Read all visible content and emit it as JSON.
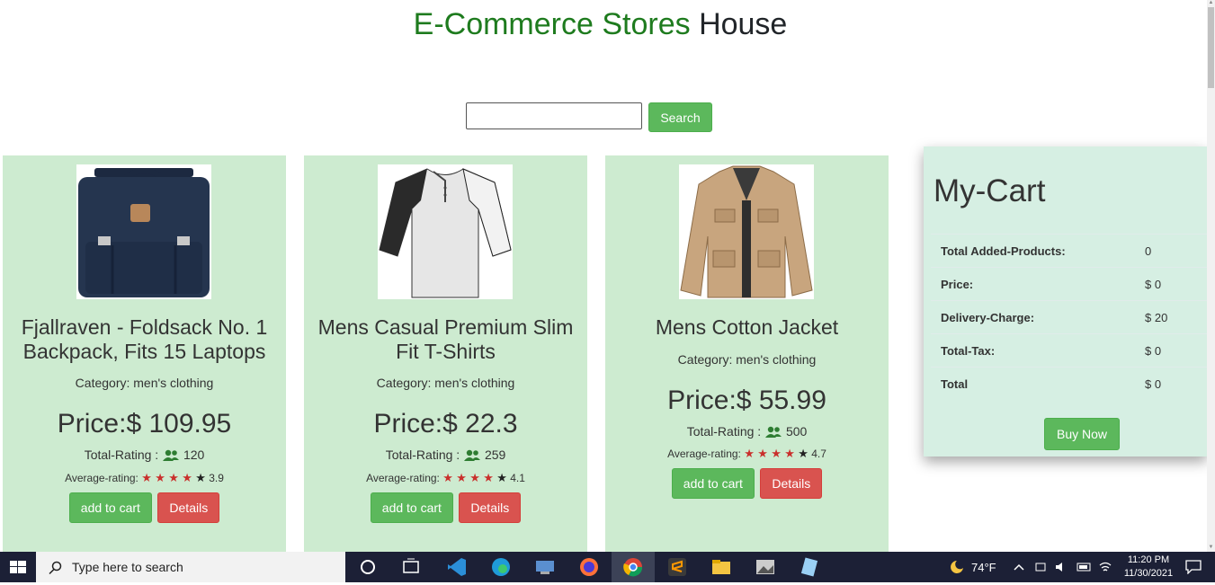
{
  "header": {
    "title_accent": "E-Commerce Stores",
    "title_plain": "House"
  },
  "search": {
    "button_label": "Search",
    "value": ""
  },
  "products": [
    {
      "name": "Fjallraven - Foldsack No. 1 Backpack, Fits 15 Laptops",
      "category": "Category: men's clothing",
      "price": "Price:$ 109.95",
      "total_rating_label": "Total-Rating :",
      "total_rating": "120",
      "avg_rating_label": "Average-rating:",
      "avg_rating": "3.9",
      "add_label": "add to cart",
      "details_label": "Details"
    },
    {
      "name": "Mens Casual Premium Slim Fit T-Shirts",
      "category": "Category: men's clothing",
      "price": "Price:$ 22.3",
      "total_rating_label": "Total-Rating :",
      "total_rating": "259",
      "avg_rating_label": "Average-rating:",
      "avg_rating": "4.1",
      "add_label": "add to cart",
      "details_label": "Details"
    },
    {
      "name": "Mens Cotton Jacket",
      "category": "Category: men's clothing",
      "price": "Price:$ 55.99",
      "total_rating_label": "Total-Rating :",
      "total_rating": "500",
      "avg_rating_label": "Average-rating:",
      "avg_rating": "4.7",
      "add_label": "add to cart",
      "details_label": "Details"
    }
  ],
  "cart": {
    "title": "My-Cart",
    "rows": [
      {
        "label": "Total Added-Products:",
        "value": "0"
      },
      {
        "label": "Price:",
        "value": "$ 0"
      },
      {
        "label": "Delivery-Charge:",
        "value": "$ 20"
      },
      {
        "label": "Total-Tax:",
        "value": "$ 0"
      },
      {
        "label": "Total",
        "value": "$ 0"
      }
    ],
    "buy_label": "Buy Now"
  },
  "taskbar": {
    "search_placeholder": "Type here to search",
    "temperature": "74°F",
    "time": "11:20 PM",
    "date": "11/30/2021"
  },
  "colors": {
    "card_bg": "#cdebd0",
    "cart_bg": "#d6efe3",
    "success": "#5cb85c",
    "danger": "#d9534f",
    "title_green": "#1e7b1e"
  }
}
